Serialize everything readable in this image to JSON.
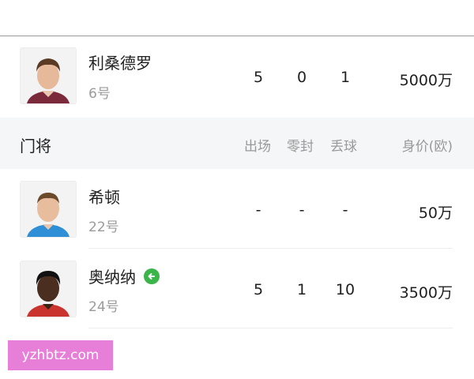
{
  "columns": {
    "section_title": "门将",
    "appearances": "出场",
    "clean_sheets": "零封",
    "goals_conceded": "丢球",
    "value": "身价(欧)"
  },
  "players": [
    {
      "name": "利桑德罗",
      "number": "6号",
      "appearances": "5",
      "clean_sheets": "0",
      "goals_conceded": "1",
      "value": "5000万",
      "badge": null
    },
    {
      "name": "希顿",
      "number": "22号",
      "appearances": "-",
      "clean_sheets": "-",
      "goals_conceded": "-",
      "value": "50万",
      "badge": null
    },
    {
      "name": "奥纳纳",
      "number": "24号",
      "appearances": "5",
      "clean_sheets": "1",
      "goals_conceded": "10",
      "value": "3500万",
      "badge": "substituted-off-icon"
    }
  ],
  "watermark": "yzhbtz.com",
  "colors": {
    "badge": "#3bb54a",
    "watermark_bg": "#e77fd9",
    "header_bg": "#f5f6f8"
  }
}
